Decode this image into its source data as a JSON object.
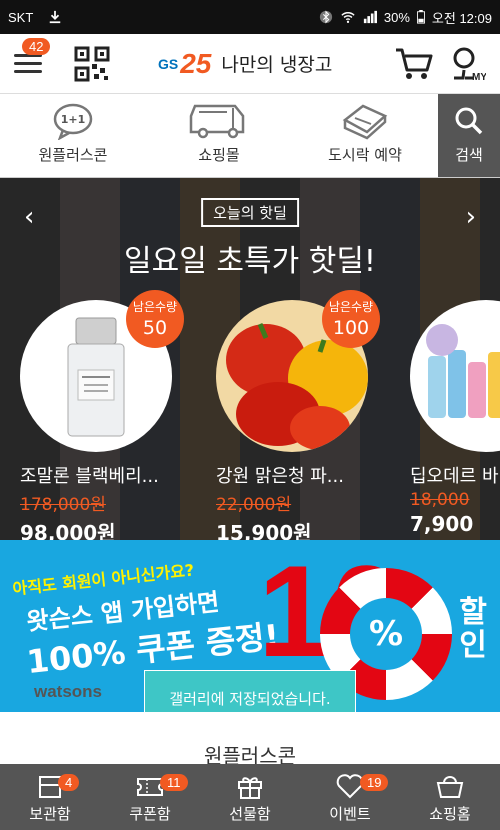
{
  "status_bar": {
    "carrier": "SKT",
    "battery": "30%",
    "time": "오전 12:09"
  },
  "header": {
    "menu_badge": "42",
    "brand_gs": "GS",
    "brand_num": "25",
    "title": "나만의 냉장고",
    "my_label": "MY"
  },
  "categories": [
    {
      "label": "원플러스콘",
      "icon": "one-plus-one-icon"
    },
    {
      "label": "쇼핑몰",
      "icon": "truck-icon"
    },
    {
      "label": "도시락 예약",
      "icon": "lunchbox-icon"
    },
    {
      "label": "검색",
      "icon": "search-icon"
    }
  ],
  "deal": {
    "tag": "오늘의 핫딜",
    "headline": "일요일 초특가 핫딜!",
    "remaining_label": "남은수량",
    "products": [
      {
        "name": "조말론 블랙베리...",
        "old_price": "178,000원",
        "price": "98,000원",
        "remaining": "50"
      },
      {
        "name": "강원 맑은청 파...",
        "old_price": "22,000원",
        "price": "15,900원",
        "remaining": "100"
      },
      {
        "name": "딥오데르 바",
        "old_price": "18,000",
        "price": "7,900"
      }
    ]
  },
  "banner": {
    "question": "아직도 회원이 아니신가요?",
    "line1": "왓슨스 앱 가입하면",
    "line2": "100% 쿠폰 증정!",
    "big_number": "10",
    "percent": "%",
    "sale_top": "할",
    "sale_bottom": "인",
    "brand": "watsons"
  },
  "toast": "갤러리에 저장되었습니다.",
  "section_title": "원플러스콘",
  "bottom_nav": [
    {
      "label": "보관함",
      "badge": "4",
      "icon": "box-icon"
    },
    {
      "label": "쿠폰함",
      "badge": "11",
      "icon": "coupon-icon"
    },
    {
      "label": "선물함",
      "badge": "",
      "icon": "gift-icon"
    },
    {
      "label": "이벤트",
      "badge": "19",
      "icon": "heart-icon"
    },
    {
      "label": "쇼핑홈",
      "badge": "",
      "icon": "basket-icon"
    }
  ],
  "colors": {
    "accent": "#f15a22",
    "brand_blue": "#0072bc",
    "banner_bg": "#19a7e0",
    "nav_bg": "#555555"
  }
}
